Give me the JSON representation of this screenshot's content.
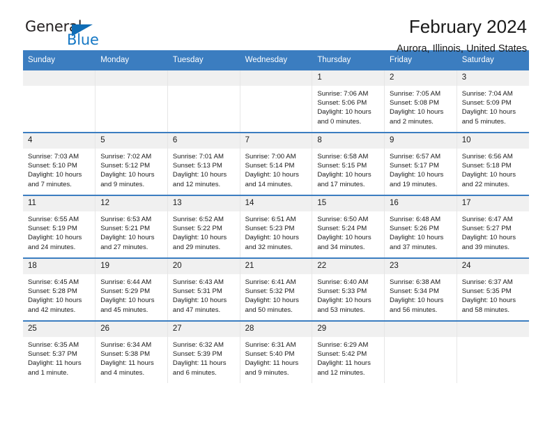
{
  "logo": {
    "word_top": "General",
    "word_bottom": "Blue",
    "triangle_icon": "blue-triangle-icon",
    "brand_color": "#1477c4"
  },
  "header": {
    "title": "February 2024",
    "subtitle": "Aurora, Illinois, United States"
  },
  "theme": {
    "header_bg": "#3b7dc0",
    "daynum_bg": "#f0f0f0",
    "row_rule": "#3b7dc0"
  },
  "labels": {
    "sunrise": "Sunrise:",
    "sunset": "Sunset:",
    "daylight": "Daylight:"
  },
  "columns": [
    "Sunday",
    "Monday",
    "Tuesday",
    "Wednesday",
    "Thursday",
    "Friday",
    "Saturday"
  ],
  "weeks": [
    [
      {
        "day": "",
        "empty": true
      },
      {
        "day": "",
        "empty": true
      },
      {
        "day": "",
        "empty": true
      },
      {
        "day": "",
        "empty": true
      },
      {
        "day": "1",
        "sunrise": "Sunrise: 7:06 AM",
        "sunset": "Sunset: 5:06 PM",
        "daylight": "Daylight: 10 hours and 0 minutes."
      },
      {
        "day": "2",
        "sunrise": "Sunrise: 7:05 AM",
        "sunset": "Sunset: 5:08 PM",
        "daylight": "Daylight: 10 hours and 2 minutes."
      },
      {
        "day": "3",
        "sunrise": "Sunrise: 7:04 AM",
        "sunset": "Sunset: 5:09 PM",
        "daylight": "Daylight: 10 hours and 5 minutes."
      }
    ],
    [
      {
        "day": "4",
        "sunrise": "Sunrise: 7:03 AM",
        "sunset": "Sunset: 5:10 PM",
        "daylight": "Daylight: 10 hours and 7 minutes."
      },
      {
        "day": "5",
        "sunrise": "Sunrise: 7:02 AM",
        "sunset": "Sunset: 5:12 PM",
        "daylight": "Daylight: 10 hours and 9 minutes."
      },
      {
        "day": "6",
        "sunrise": "Sunrise: 7:01 AM",
        "sunset": "Sunset: 5:13 PM",
        "daylight": "Daylight: 10 hours and 12 minutes."
      },
      {
        "day": "7",
        "sunrise": "Sunrise: 7:00 AM",
        "sunset": "Sunset: 5:14 PM",
        "daylight": "Daylight: 10 hours and 14 minutes."
      },
      {
        "day": "8",
        "sunrise": "Sunrise: 6:58 AM",
        "sunset": "Sunset: 5:15 PM",
        "daylight": "Daylight: 10 hours and 17 minutes."
      },
      {
        "day": "9",
        "sunrise": "Sunrise: 6:57 AM",
        "sunset": "Sunset: 5:17 PM",
        "daylight": "Daylight: 10 hours and 19 minutes."
      },
      {
        "day": "10",
        "sunrise": "Sunrise: 6:56 AM",
        "sunset": "Sunset: 5:18 PM",
        "daylight": "Daylight: 10 hours and 22 minutes."
      }
    ],
    [
      {
        "day": "11",
        "sunrise": "Sunrise: 6:55 AM",
        "sunset": "Sunset: 5:19 PM",
        "daylight": "Daylight: 10 hours and 24 minutes."
      },
      {
        "day": "12",
        "sunrise": "Sunrise: 6:53 AM",
        "sunset": "Sunset: 5:21 PM",
        "daylight": "Daylight: 10 hours and 27 minutes."
      },
      {
        "day": "13",
        "sunrise": "Sunrise: 6:52 AM",
        "sunset": "Sunset: 5:22 PM",
        "daylight": "Daylight: 10 hours and 29 minutes."
      },
      {
        "day": "14",
        "sunrise": "Sunrise: 6:51 AM",
        "sunset": "Sunset: 5:23 PM",
        "daylight": "Daylight: 10 hours and 32 minutes."
      },
      {
        "day": "15",
        "sunrise": "Sunrise: 6:50 AM",
        "sunset": "Sunset: 5:24 PM",
        "daylight": "Daylight: 10 hours and 34 minutes."
      },
      {
        "day": "16",
        "sunrise": "Sunrise: 6:48 AM",
        "sunset": "Sunset: 5:26 PM",
        "daylight": "Daylight: 10 hours and 37 minutes."
      },
      {
        "day": "17",
        "sunrise": "Sunrise: 6:47 AM",
        "sunset": "Sunset: 5:27 PM",
        "daylight": "Daylight: 10 hours and 39 minutes."
      }
    ],
    [
      {
        "day": "18",
        "sunrise": "Sunrise: 6:45 AM",
        "sunset": "Sunset: 5:28 PM",
        "daylight": "Daylight: 10 hours and 42 minutes."
      },
      {
        "day": "19",
        "sunrise": "Sunrise: 6:44 AM",
        "sunset": "Sunset: 5:29 PM",
        "daylight": "Daylight: 10 hours and 45 minutes."
      },
      {
        "day": "20",
        "sunrise": "Sunrise: 6:43 AM",
        "sunset": "Sunset: 5:31 PM",
        "daylight": "Daylight: 10 hours and 47 minutes."
      },
      {
        "day": "21",
        "sunrise": "Sunrise: 6:41 AM",
        "sunset": "Sunset: 5:32 PM",
        "daylight": "Daylight: 10 hours and 50 minutes."
      },
      {
        "day": "22",
        "sunrise": "Sunrise: 6:40 AM",
        "sunset": "Sunset: 5:33 PM",
        "daylight": "Daylight: 10 hours and 53 minutes."
      },
      {
        "day": "23",
        "sunrise": "Sunrise: 6:38 AM",
        "sunset": "Sunset: 5:34 PM",
        "daylight": "Daylight: 10 hours and 56 minutes."
      },
      {
        "day": "24",
        "sunrise": "Sunrise: 6:37 AM",
        "sunset": "Sunset: 5:35 PM",
        "daylight": "Daylight: 10 hours and 58 minutes."
      }
    ],
    [
      {
        "day": "25",
        "sunrise": "Sunrise: 6:35 AM",
        "sunset": "Sunset: 5:37 PM",
        "daylight": "Daylight: 11 hours and 1 minute."
      },
      {
        "day": "26",
        "sunrise": "Sunrise: 6:34 AM",
        "sunset": "Sunset: 5:38 PM",
        "daylight": "Daylight: 11 hours and 4 minutes."
      },
      {
        "day": "27",
        "sunrise": "Sunrise: 6:32 AM",
        "sunset": "Sunset: 5:39 PM",
        "daylight": "Daylight: 11 hours and 6 minutes."
      },
      {
        "day": "28",
        "sunrise": "Sunrise: 6:31 AM",
        "sunset": "Sunset: 5:40 PM",
        "daylight": "Daylight: 11 hours and 9 minutes."
      },
      {
        "day": "29",
        "sunrise": "Sunrise: 6:29 AM",
        "sunset": "Sunset: 5:42 PM",
        "daylight": "Daylight: 11 hours and 12 minutes."
      },
      {
        "day": "",
        "empty": true
      },
      {
        "day": "",
        "empty": true
      }
    ]
  ]
}
